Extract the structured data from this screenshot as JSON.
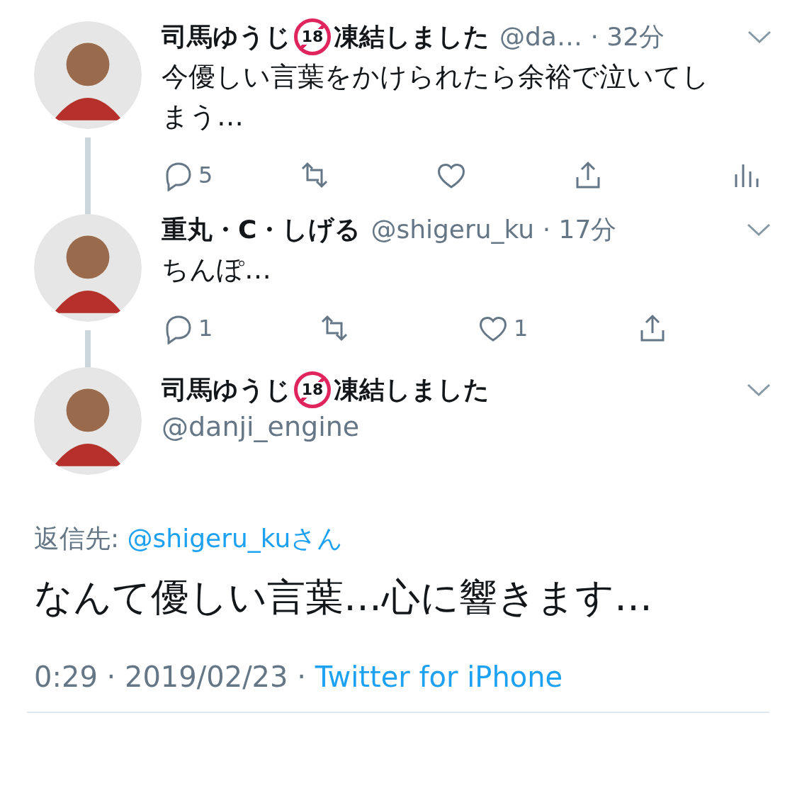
{
  "thread": [
    {
      "name": "司馬ゆうじ",
      "badge": "18",
      "name_suffix": "凍結しました",
      "handle": "@da…",
      "time": "· 32分",
      "text": "今優しい言葉をかけられたら余裕で泣いてしまう…",
      "actions": [
        {
          "kind": "reply",
          "count": "5"
        },
        {
          "kind": "retweet"
        },
        {
          "kind": "like"
        },
        {
          "kind": "share"
        },
        {
          "kind": "analytics"
        }
      ]
    },
    {
      "name": "重丸・C・しげる",
      "handle": "@shigeru_ku",
      "time": "· 17分",
      "text": "ちんぽ…",
      "actions": [
        {
          "kind": "reply",
          "count": "1"
        },
        {
          "kind": "retweet"
        },
        {
          "kind": "like",
          "count": "1"
        },
        {
          "kind": "share"
        }
      ]
    }
  ],
  "main": {
    "name": "司馬ゆうじ",
    "badge": "18",
    "name_suffix": "凍結しました",
    "handle": "@danji_engine",
    "reply_to_label": "返信先:",
    "reply_to": "@shigeru_kuさん",
    "text": "なんて優しい言葉…心に響きます…",
    "timestamp": "0:29 · 2019/02/23 ·",
    "source": "Twitter for iPhone"
  }
}
